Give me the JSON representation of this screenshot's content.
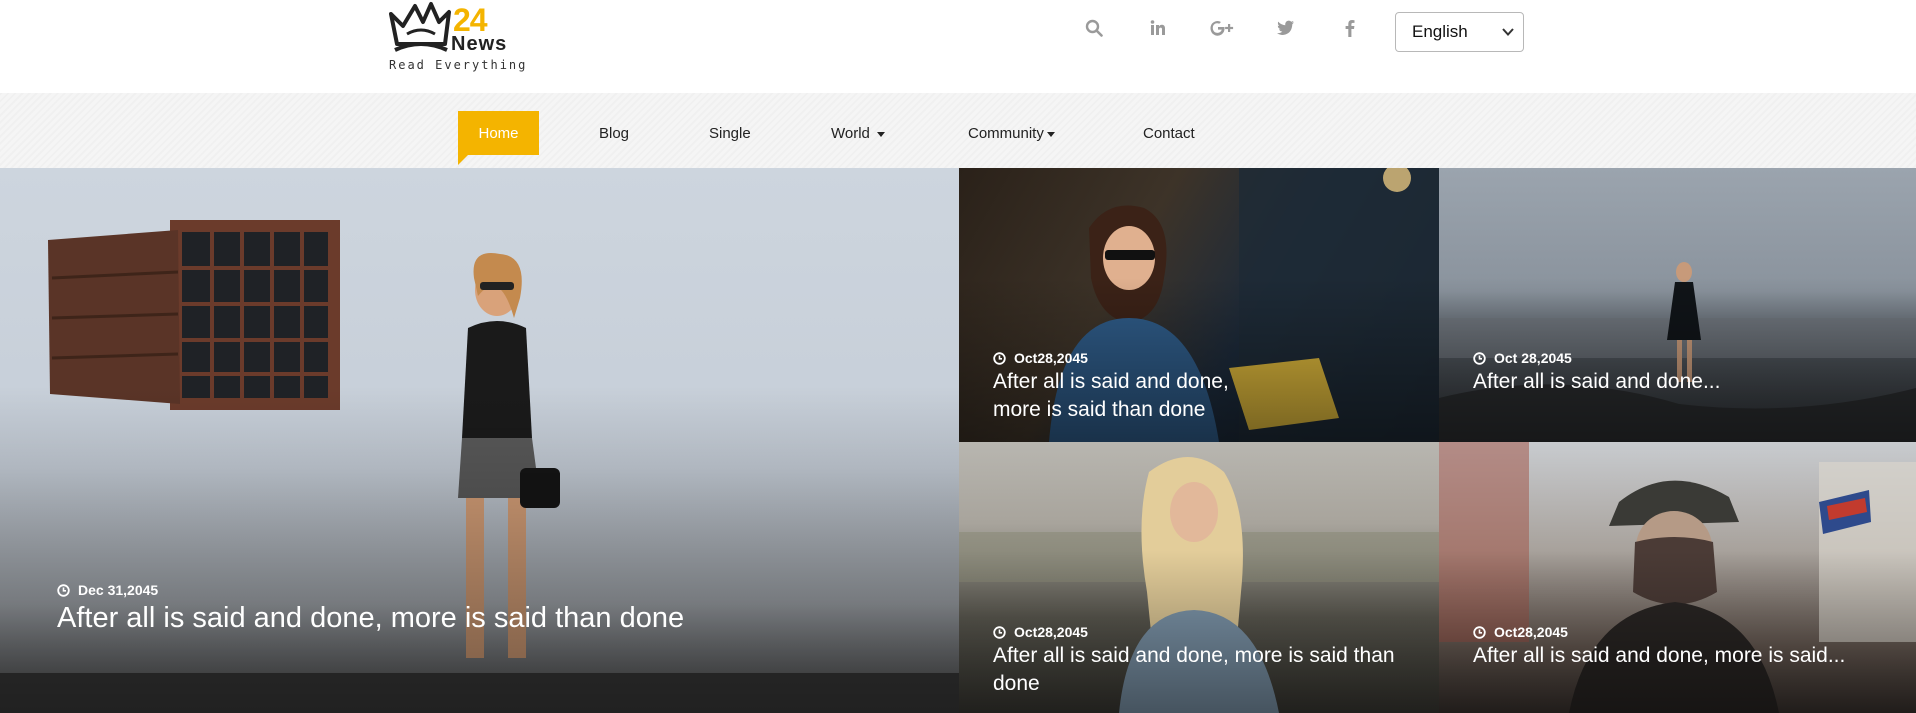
{
  "brand": {
    "number": "24",
    "word": "News",
    "tagline": "Read Everything",
    "accent": "#f4b400"
  },
  "header": {
    "icons": [
      "search-icon",
      "linkedin-icon",
      "google-plus-icon",
      "twitter-icon",
      "facebook-icon"
    ],
    "language": "English"
  },
  "nav": {
    "items": [
      {
        "label": "Home",
        "active": true,
        "dropdown": false
      },
      {
        "label": "Blog",
        "active": false,
        "dropdown": false
      },
      {
        "label": "Single",
        "active": false,
        "dropdown": false
      },
      {
        "label": "World",
        "active": false,
        "dropdown": true
      },
      {
        "label": "Community",
        "active": false,
        "dropdown": true
      },
      {
        "label": "Contact",
        "active": false,
        "dropdown": false
      }
    ]
  },
  "posts": [
    {
      "date": "Dec 31,2045",
      "title": "After all is said and done, more is said than done"
    },
    {
      "date": "Oct28,2045",
      "title_line1": "After all is said and done,",
      "title_line2": "more is said than done"
    },
    {
      "date": "Oct 28,2045",
      "title": "After all is said and done..."
    },
    {
      "date": "Oct28,2045",
      "title_line1": "After all is said and done, more is said than",
      "title_line2": "done"
    },
    {
      "date": "Oct28,2045",
      "title": "After all is said and done, more is said..."
    }
  ]
}
